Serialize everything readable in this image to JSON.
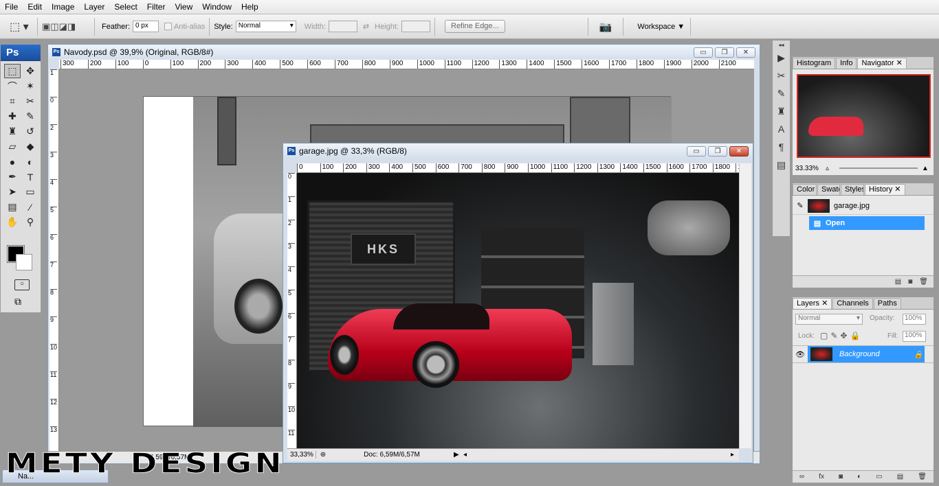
{
  "menu": [
    "File",
    "Edit",
    "Image",
    "Layer",
    "Select",
    "Filter",
    "View",
    "Window",
    "Help"
  ],
  "options": {
    "feather_label": "Feather:",
    "feather_value": "0 px",
    "antialias_label": "Anti-alias",
    "style_label": "Style:",
    "style_value": "Normal",
    "width_label": "Width:",
    "height_label": "Height:",
    "refine_edge": "Refine Edge...",
    "workspace": "Workspace"
  },
  "toolbox": {
    "logo": "Ps"
  },
  "doc1": {
    "title": "Navody.psd @ 39,9% (Original, RGB/8#)",
    "status": "6,59M/6,57M",
    "ruler": [
      "300",
      "200",
      "100",
      "0",
      "100",
      "200",
      "300",
      "400",
      "500",
      "600",
      "700",
      "800",
      "900",
      "1000",
      "1100",
      "1200",
      "1300",
      "1400",
      "1500",
      "1600",
      "1700",
      "1800",
      "1900",
      "2000",
      "2100"
    ]
  },
  "doc2": {
    "title": "garage.jpg @ 33,3% (RGB/8)",
    "zoom": "33,33%",
    "status": "Doc: 6,59M/6,57M",
    "ruler": [
      "0",
      "100",
      "200",
      "300",
      "400",
      "500",
      "600",
      "700",
      "800",
      "900",
      "1000",
      "1100",
      "1200",
      "1300",
      "1400",
      "1500",
      "1600",
      "1700",
      "1800",
      "1"
    ],
    "sign": "HKS"
  },
  "navigator": {
    "tabs": [
      "Histogram",
      "Info",
      "Navigator"
    ],
    "zoom": "33.33%"
  },
  "history": {
    "tabs": [
      "Color",
      "Swatc",
      "Styles",
      "History"
    ],
    "snapshot": "garage.jpg",
    "step": "Open"
  },
  "layers": {
    "tabs": [
      "Layers",
      "Channels",
      "Paths"
    ],
    "blend": "Normal",
    "opacity_label": "Opacity:",
    "opacity": "100%",
    "lock_label": "Lock:",
    "fill_label": "Fill:",
    "fill": "100%",
    "layer_name": "Background"
  },
  "taskbar": {
    "label": "Na..."
  },
  "watermark": "METY DESIGN",
  "colors": {
    "accent": "#3399ff",
    "fg": "#000000",
    "bg": "#ffffff"
  }
}
